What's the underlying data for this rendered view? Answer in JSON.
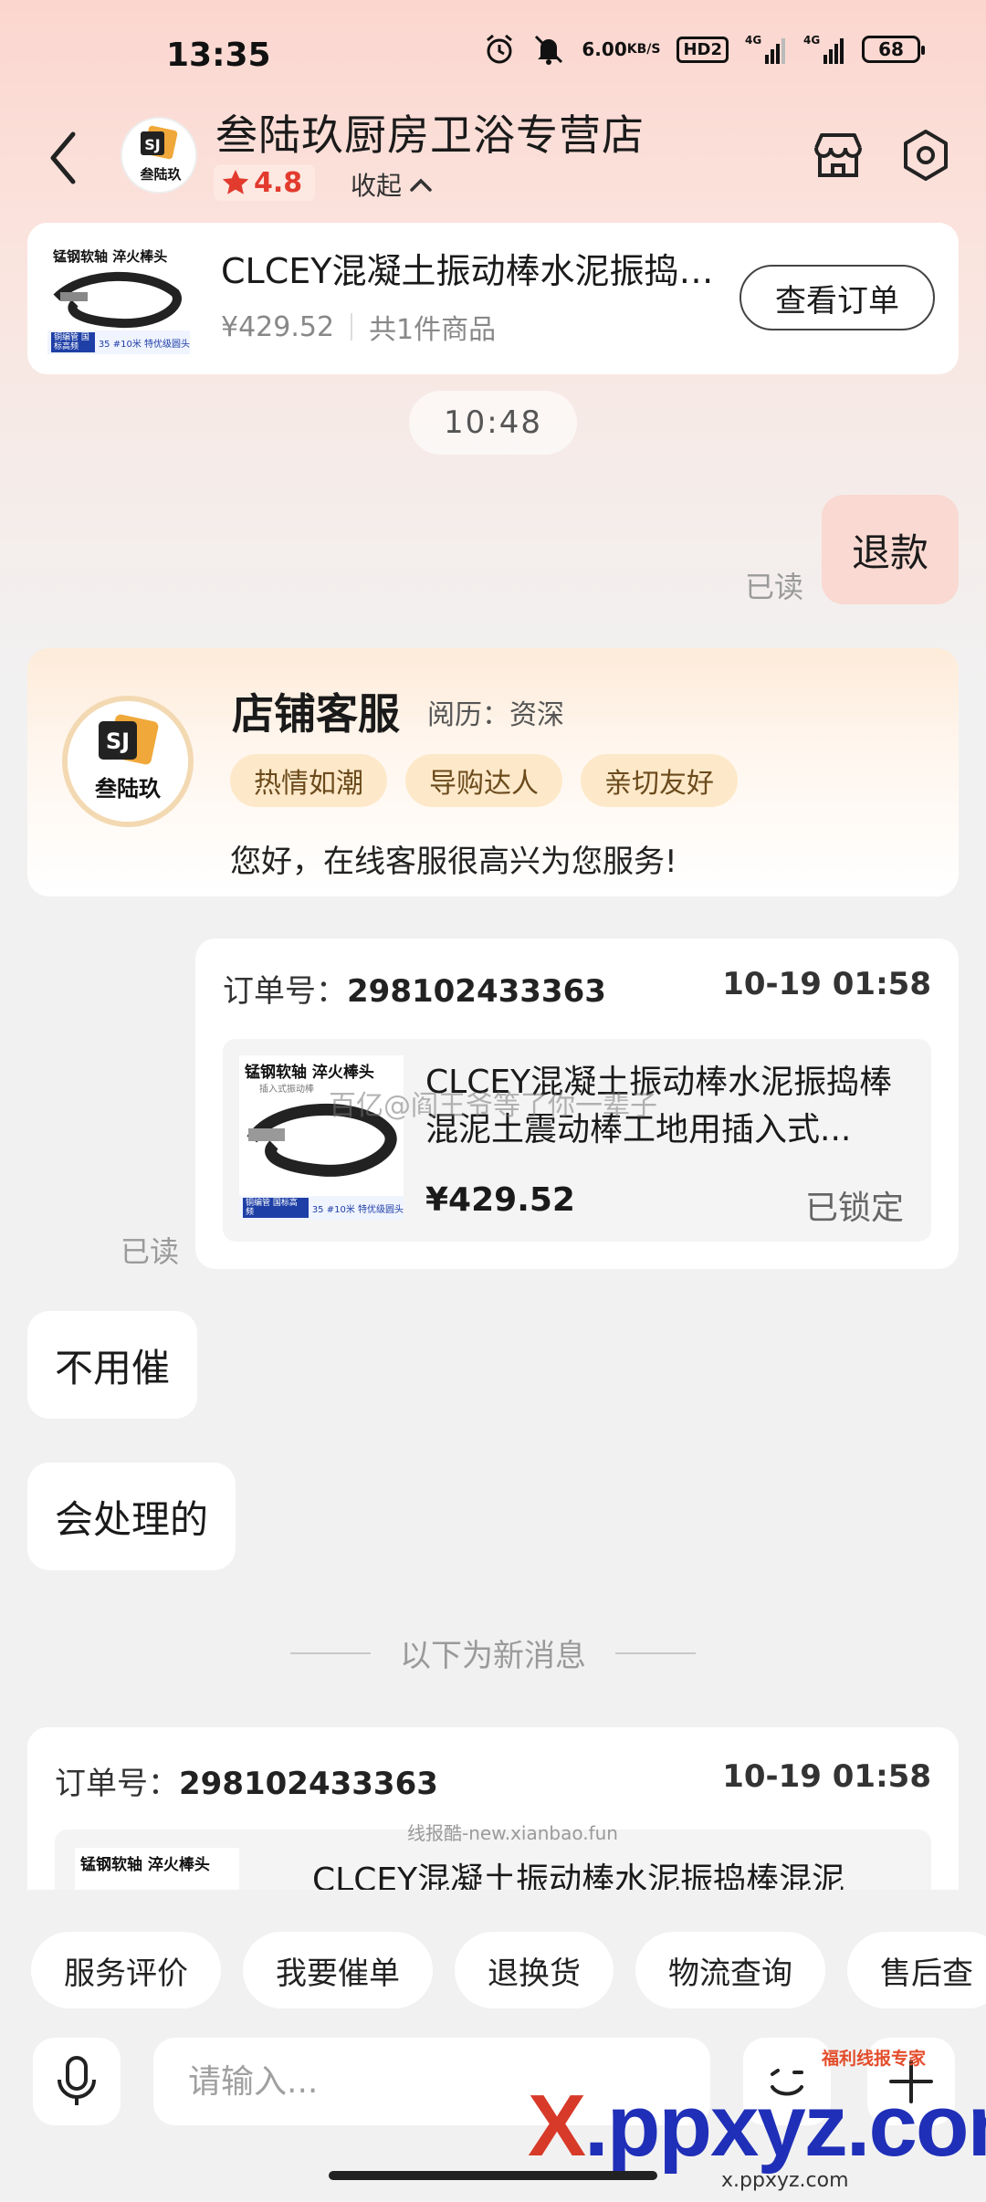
{
  "status_bar": {
    "time": "13:35",
    "net_speed": "6.00",
    "net_unit": "KB/S",
    "hd_label": "HD2",
    "net1": "4G",
    "net2": "4G",
    "battery": "68"
  },
  "header": {
    "shop_name": "叁陆玖厨房卫浴专营店",
    "rating": "4.8",
    "collapse_label": "收起",
    "avatar_text": "叁陆玖"
  },
  "order_card": {
    "title": "CLCEY混凝土振动棒水泥振捣棒混泥土震动棒工地用插入式",
    "price": "¥429.52",
    "count": "共1件商品",
    "view_button": "查看订单"
  },
  "chat": {
    "time_chip": "10:48",
    "refund_message": "退款",
    "read_label": "已读",
    "service_card": {
      "title": "店铺客服",
      "experience": "阅历：资深",
      "tags": [
        "热情如潮",
        "导购达人",
        "亲切友好"
      ],
      "greeting": "您好，在线客服很高兴为您服务!"
    },
    "product_card_1": {
      "order_label": "订单号：",
      "order_no": "298102433363",
      "time": "10-19 01:58",
      "title": "CLCEY混凝土振动棒水泥振捣棒混泥土震动棒工地用插入式...",
      "price": "¥429.52",
      "status": "已锁定",
      "thumb_top": "锰钢软轴 淬火棒头",
      "thumb_sub": "插入式振动棒",
      "thumb_badge": "铜编管 国标高频",
      "thumb_note": "35 #10米 特优级圆头"
    },
    "watermark_1": "百亿@阎王爷等了你一辈子",
    "messages_in": [
      "不用催",
      "会处理的"
    ],
    "new_divider": "以下为新消息",
    "product_card_2": {
      "order_label": "订单号：",
      "order_no": "298102433363",
      "time": "10-19 01:58",
      "title": "CLCEY混凝土振动棒水泥振捣棒混泥",
      "thumb_top": "锰钢软轴 淬火棒头",
      "watermark": "线报酷-new.xianbao.fun"
    }
  },
  "quick_actions": [
    "服务评价",
    "我要催单",
    "退换货",
    "物流查询",
    "售后查"
  ],
  "input": {
    "placeholder": "请输入..."
  },
  "footer_watermark": {
    "badge": "福利线报专家",
    "big_x": "X",
    "big_rest": ".ppxyz.com",
    "small": "x.ppxyz.com"
  },
  "colors": {
    "accent_red": "#e23b2e",
    "refund_bubble": "#f9d9d1",
    "tag_bg": "#fde9c9"
  }
}
